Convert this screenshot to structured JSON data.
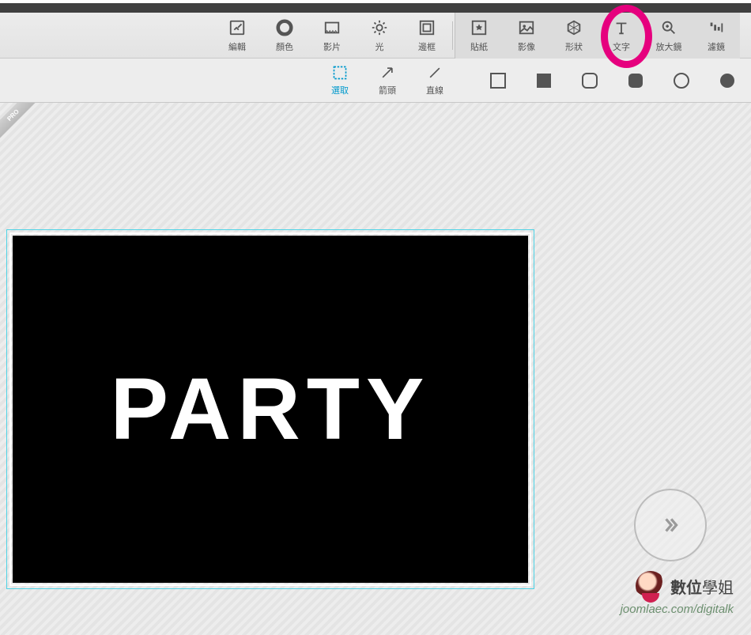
{
  "toolbar": {
    "edit": "編輯",
    "color": "顏色",
    "clip": "影片",
    "light": "光",
    "border": "邊框",
    "sticker": "貼紙",
    "image": "影像",
    "shape": "形狀",
    "text": "文字",
    "zoom": "放大鏡",
    "filter": "濾鏡"
  },
  "subtoolbar": {
    "select": "選取",
    "arrow": "箭頭",
    "line": "直線"
  },
  "canvas": {
    "text": "PARTY"
  },
  "pro_badge": "PRO",
  "watermark": {
    "title_bold": "數位",
    "title_rest": "學姐",
    "url": "joomlaec.com/digitalk"
  }
}
